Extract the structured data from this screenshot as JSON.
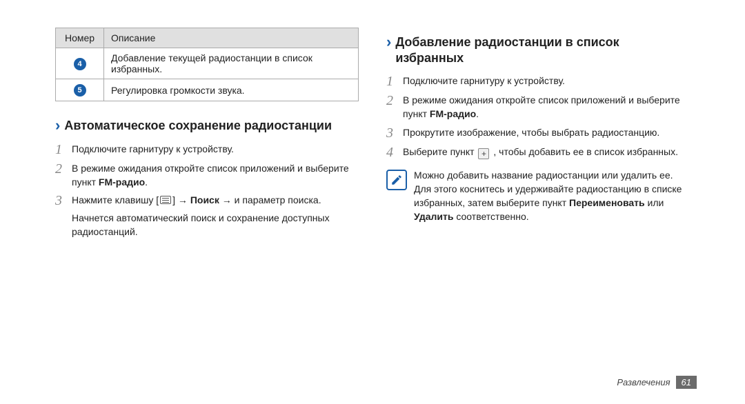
{
  "table": {
    "head_num": "Номер",
    "head_desc": "Описание",
    "rows": [
      {
        "num": "4",
        "desc": "Добавление текущей радиостанции в список избранных."
      },
      {
        "num": "5",
        "desc": "Регулировка громкости звука."
      }
    ]
  },
  "left": {
    "heading": "Автоматическое сохранение радиостанции",
    "steps": {
      "s1": "Подключите гарнитуру к устройству.",
      "s2_a": "В режиме ожидания откройте список приложений и выберите пункт ",
      "s2_b": "FM-радио",
      "s2_c": ".",
      "s3_a": "Нажмите клавишу [",
      "s3_b": "] → ",
      "s3_c": "Поиск",
      "s3_d": " → и параметр поиска."
    },
    "cont": "Начнется автоматический поиск и сохранение доступных радиостанций."
  },
  "right": {
    "heading": "Добавление радиостанции в список избранных",
    "steps": {
      "s1": "Подключите гарнитуру к устройству.",
      "s2_a": "В режиме ожидания откройте список приложений и выберите пункт ",
      "s2_b": "FM-радио",
      "s2_c": ".",
      "s3": "Прокрутите изображение, чтобы выбрать радиостанцию.",
      "s4_a": "Выберите пункт ",
      "s4_b": " , чтобы добавить ее в список избранных."
    },
    "note_a": "Можно добавить название радиостанции или удалить ее. Для этого коснитесь и удерживайте радиостанцию в списке избранных, затем выберите пункт ",
    "note_b": "Переименовать",
    "note_c": " или ",
    "note_d": "Удалить",
    "note_e": " соответственно."
  },
  "footer": {
    "category": "Развлечения",
    "pagenum": "61"
  },
  "glyphs": {
    "plus": "+"
  }
}
